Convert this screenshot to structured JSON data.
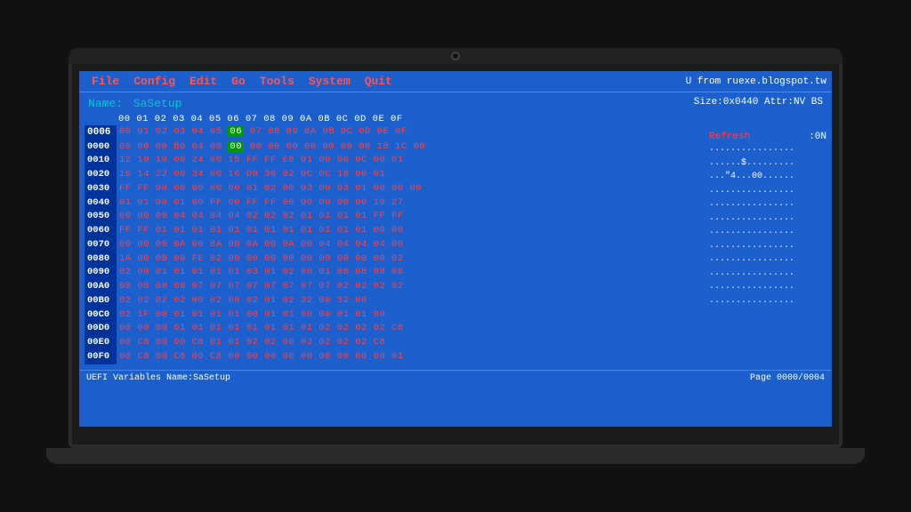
{
  "menu": {
    "items": [
      "File",
      "Config",
      "Edit",
      "Go",
      "Tools",
      "System",
      "Quit"
    ],
    "right_text": "U from ruexe.blogspot.tw"
  },
  "header": {
    "name_label": "Name:",
    "name_value": "SaSetup",
    "size_label": "Size:0x0440  Attr:NV BS"
  },
  "hex_header": "00 01 02 03 04 05 06 07 08 09 0A 0B 0C 0D 0E 0F",
  "rows": [
    {
      "addr": "0006",
      "bytes": "00 01 02 03 04 05 06 07 08 09 0A 0B 0C 0D 0E 0F",
      "highlight_col": 6
    },
    {
      "addr": "0000",
      "bytes": "00 00 00 B0 04 00 00 00 00 00 00 00 00 00 18 1C 00"
    },
    {
      "addr": "0010",
      "bytes": "12 10 10 00 24 00 15 FF FF E8 01 00 06 0C 00 01"
    },
    {
      "addr": "0020",
      "bytes": "16 14 22 00 34 00 16 D0 30 02 0C 18 00 01"
    },
    {
      "addr": "0030",
      "bytes": "FF FF 00 00 00 00 01 02 00 03 00 03 01 00 00 00"
    },
    {
      "addr": "0040",
      "bytes": "01 01 00 01 00 FF 00 FF FF 00 00 00 00 00 10 27"
    },
    {
      "addr": "0050",
      "bytes": "00 00 00 04 04 04 04 02 02 02 01 01 01 01 FF FF"
    },
    {
      "addr": "0060",
      "bytes": "FF FF 01 01 01 01 01 01 01 01 01 01 01 01 00 00"
    },
    {
      "addr": "0070",
      "bytes": "00 00 00 0A 00 0A 00 0A 00 0A 00 04 04 04 04 00"
    },
    {
      "addr": "0080",
      "bytes": "1A 00 0B 00 FE 02 00 00 00 00 00 00 00 00 00 02"
    },
    {
      "addr": "0090",
      "bytes": "02 00 01 01 01 01 01 03 01 02 00 01 08 08 08 08"
    },
    {
      "addr": "00A0",
      "bytes": "08 08 08 08 07 07 07 07 07 07 07 07 02 02 02 02"
    },
    {
      "addr": "00B0",
      "bytes": "02 02 02 02 00 02 00 02 01 02 32 00 32 00"
    },
    {
      "addr": "00C0",
      "bytes": "02 1F 00 01 01 01 01 00 01 01 00 00 01 01 00"
    },
    {
      "addr": "00D0",
      "bytes": "00 00 00 01 01 01 01 01 01 01 01 02 02 02 02 C8"
    },
    {
      "addr": "00E0",
      "bytes": "00 C8 00 00 C8 01 01 02 02 00 02 02 02 02 C8"
    },
    {
      "addr": "00F0",
      "bytes": "00 C8 00 C8 00 C8 00 00 00 00 00 00 00 00 00 01"
    }
  ],
  "refresh": {
    "label": "Refresh",
    "value": ":0N"
  },
  "status": {
    "left": "UEFI Variables  Name:SaSetup",
    "right": "Page 0000/0004"
  }
}
